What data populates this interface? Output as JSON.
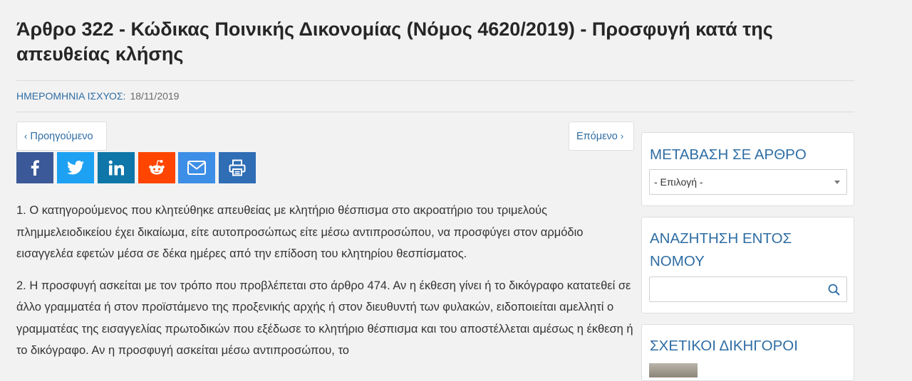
{
  "article": {
    "title": "Άρθρο 322 - Κώδικας Ποινικής Δικονομίας (Νόμος 4620/2019) - Προσφυγή κατά της απευθείας κλήσης",
    "date_label": "ΗΜΕΡΟΜΗΝΙΑ ΙΣΧΥΟΣ:",
    "date_value": "18/11/2019",
    "prev_label": "Προηγούμενο",
    "next_label": "Επόμενο",
    "paragraphs": [
      "1. Ο κατηγορούμενος που κλητεύθηκε απευθείας με κλητήριο θέσπισμα στο ακροατήριο του τριμελούς πλημμελειοδικείου έχει δικαίωμα, είτε αυτοπροσώπως είτε μέσω αντιπροσώπου, να προσφύγει στον αρμόδιο εισαγγελέα εφετών μέσα σε δέκα ημέρες από την επίδοση του κλητηρίου θεσπίσματος.",
      "2. Η προσφυγή ασκείται με τον τρόπο που προβλέπεται στο άρθρο 474. Αν η έκθεση γίνει ή το δικόγραφο κατατεθεί σε άλλο γραμματέα ή στον προϊστάμενο της προξενικής αρχής ή στον διευθυντή των φυλακών, ειδοποιείται αμελλητί ο γραμματέας της εισαγγελίας πρωτοδικών που εξέδωσε το κλητήριο θέσπισμα και του αποστέλλεται αμέσως η έκθεση ή το δικόγραφο. Αν η προσφυγή ασκείται μέσω αντιπροσώπου, το"
    ]
  },
  "share": [
    {
      "name": "facebook",
      "color": "#3b5998"
    },
    {
      "name": "twitter",
      "color": "#1da1f2"
    },
    {
      "name": "linkedin",
      "color": "#0e76a8"
    },
    {
      "name": "reddit",
      "color": "#ff4500"
    },
    {
      "name": "email",
      "color": "#3d8ee6"
    },
    {
      "name": "print",
      "color": "#2f6db5"
    }
  ],
  "sidebar": {
    "goto_title": "ΜΕΤΑΒΑΣΗ ΣΕ ΑΡΘΡΟ",
    "goto_selected": "- Επιλογή -",
    "search_title": "ΑΝΑΖΗΤΗΣΗ ΕΝΤΟΣ ΝΟΜΟΥ",
    "search_placeholder": "",
    "lawyers_title": "ΣΧΕΤΙΚΟΙ ΔΙΚΗΓΟΡΟΙ"
  }
}
